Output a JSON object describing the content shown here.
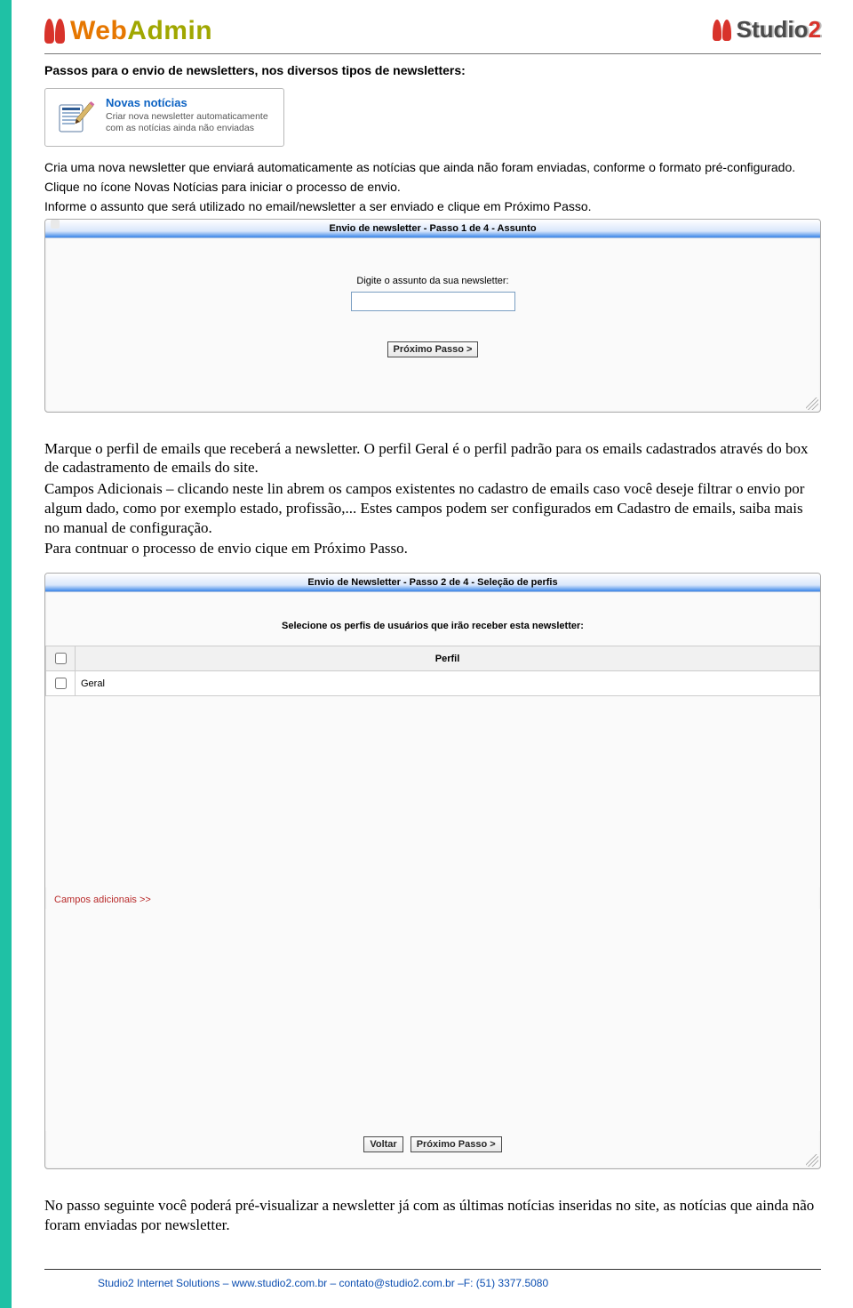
{
  "header": {
    "logo_left_web": "Web",
    "logo_left_admin": "Admin",
    "logo_right_studio": "Studio",
    "logo_right_two": "2"
  },
  "heading": "Passos para o envio de newsletters, nos diversos tipos de newsletters:",
  "novas_card": {
    "title": "Novas notícias",
    "desc": "Criar nova newsletter automaticamente com as notícias ainda não enviadas"
  },
  "paras_1": [
    "Cria uma nova newsletter que enviará automaticamente  as notícias que ainda não foram enviadas, conforme o formato pré-configurado.",
    "Clique no ícone Novas Notícias para iniciar o processo de envio.",
    "Informe o assunto que será utilizado no email/newsletter a ser enviado e clique em Próximo Passo."
  ],
  "panel1": {
    "title": "Envio de newsletter - Passo 1 de 4 - Assunto",
    "label": "Digite o assunto da sua newsletter:",
    "input_value": "",
    "btn_next": "Próximo Passo >"
  },
  "paras_serif": [
    "Marque o perfil de emails que receberá a newsletter. O perfil Geral é o perfil padrão para os emails cadastrados através do box de cadastramento de emails do site.",
    "Campos Adicionais – clicando neste lin abrem os campos existentes no cadastro de emails caso você deseje filtrar o envio por algum dado, como por exemplo estado, profissão,... Estes campos podem ser configurados em Cadastro de emails, saiba mais no manual de configuração.",
    "Para contnuar o processo de envio cique em Próximo Passo."
  ],
  "panel2": {
    "title": "Envio de Newsletter - Passo 2 de 4 - Seleção de perfis",
    "sublabel": "Selecione os perfis de usuários que irão receber esta newsletter:",
    "table": {
      "col_perfil": "Perfil",
      "rows": [
        {
          "checked": false,
          "name": "Geral"
        }
      ]
    },
    "campos_link": "Campos adicionais >>",
    "btn_back": "Voltar",
    "btn_next": "Próximo Passo >"
  },
  "paras_after_panel2": [
    "No passo seguinte você poderá pré-visualizar a newsletter já com as últimas notícias inseridas no site, as notícias que ainda não foram enviadas por newsletter."
  ],
  "footer": "Studio2 Internet Solutions – www.studio2.com.br – contato@studio2.com.br –F: (51) 3377.5080"
}
